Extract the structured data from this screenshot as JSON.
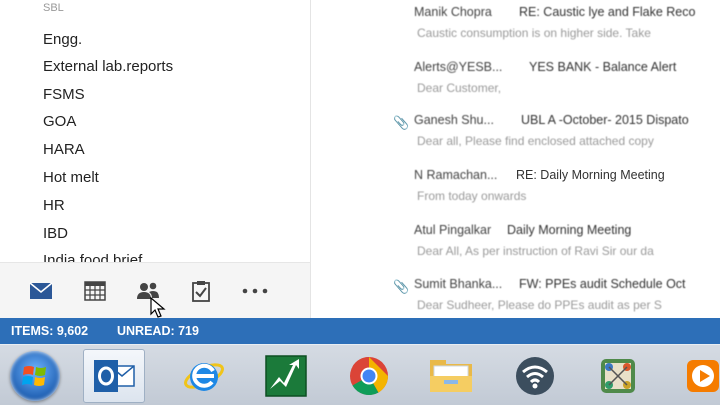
{
  "folders": [
    {
      "label": "SBL",
      "faded": true
    },
    {
      "label": "Engg."
    },
    {
      "label": "External lab.reports"
    },
    {
      "label": "FSMS"
    },
    {
      "label": "GOA"
    },
    {
      "label": "HARA"
    },
    {
      "label": "Hot melt"
    },
    {
      "label": "HR"
    },
    {
      "label": "IBD"
    },
    {
      "label": "India food brief"
    }
  ],
  "nav": [
    {
      "icon": "mail-icon"
    },
    {
      "icon": "calendar-icon"
    },
    {
      "icon": "people-icon"
    },
    {
      "icon": "tasks-icon"
    },
    {
      "icon": "more-icon"
    }
  ],
  "mails": [
    {
      "from": "Manik Chopra",
      "subject": "RE: Caustic lye and Flake Reco",
      "preview": "Caustic consumption is on higher side. Take",
      "attachment": false
    },
    {
      "from": "Alerts@YESB...",
      "subject": "YES BANK - Balance Alert",
      "preview": "Dear Customer,",
      "attachment": false
    },
    {
      "from": "Ganesh Shu...",
      "subject": "UBL A -October- 2015 Dispato",
      "preview": "Dear all, Please find enclosed attached copy",
      "attachment": true
    },
    {
      "from": "N Ramachan...",
      "subject": "RE: Daily Morning Meeting",
      "preview": "From today onwards",
      "attachment": false
    },
    {
      "from": "Atul Pingalkar",
      "subject": "Daily Morning Meeting",
      "preview": "Dear All, As per instruction of Ravi Sir our da",
      "attachment": false
    },
    {
      "from": "Sumit Bhanka...",
      "subject": "FW: PPEs audit Schedule Oct",
      "preview": "Dear Sudheer, Please do PPEs audit as per S",
      "attachment": true
    }
  ],
  "status": {
    "items": "ITEMS: 9,602",
    "unread": "UNREAD: 719"
  },
  "taskbar": [
    {
      "icon": "windows-start-icon"
    },
    {
      "icon": "outlook-icon",
      "active": true
    },
    {
      "icon": "internet-explorer-icon"
    },
    {
      "icon": "stock-chart-app-icon"
    },
    {
      "icon": "chrome-icon"
    },
    {
      "icon": "file-explorer-icon"
    },
    {
      "icon": "wifi-app-icon"
    },
    {
      "icon": "network-app-icon"
    },
    {
      "icon": "media-player-icon"
    }
  ],
  "colors": {
    "accent": "#2d6fb8",
    "nav_icon": "#2b5797"
  }
}
